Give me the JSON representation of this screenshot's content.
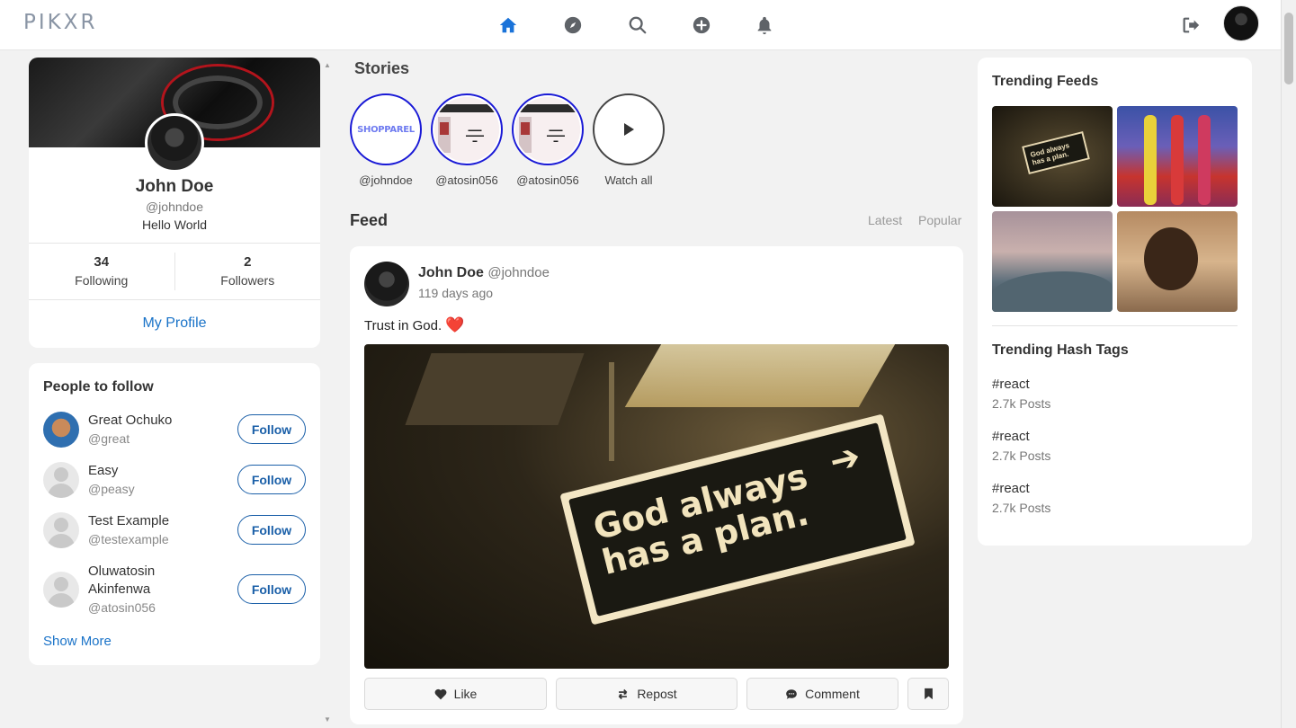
{
  "app": {
    "logo": "PIKXR"
  },
  "nav": {
    "icons": [
      "home-icon",
      "compass-icon",
      "search-icon",
      "plus-circle-icon",
      "bell-icon"
    ],
    "logout_icon": "logout-icon",
    "active_color": "#1a73d9"
  },
  "profile": {
    "name": "John Doe",
    "handle": "@johndoe",
    "bio": "Hello World",
    "following_count": "34",
    "following_label": "Following",
    "followers_count": "2",
    "followers_label": "Followers",
    "my_profile_label": "My Profile"
  },
  "people_to_follow": {
    "title": "People to follow",
    "users": [
      {
        "name": "Great Ochuko",
        "handle": "@great",
        "button": "Follow"
      },
      {
        "name": "Easy",
        "handle": "@peasy",
        "button": "Follow"
      },
      {
        "name": "Test Example",
        "handle": "@testexample",
        "button": "Follow"
      },
      {
        "name": "Oluwatosin Akinfenwa",
        "handle": "@atosin056",
        "button": "Follow"
      }
    ],
    "show_more": "Show More"
  },
  "stories": {
    "title": "Stories",
    "items": [
      {
        "label": "@johndoe",
        "thumb_text": "SHOPPAREL"
      },
      {
        "label": "@atosin056"
      },
      {
        "label": "@atosin056"
      },
      {
        "label": "Watch all"
      }
    ],
    "ring_color": "#1919d6"
  },
  "feed": {
    "title": "Feed",
    "tabs": [
      "Latest",
      "Popular"
    ]
  },
  "post": {
    "author": "John Doe",
    "handle": "@johndoe",
    "time": "119 days ago",
    "text": "Trust in God.",
    "emoji": "❤️",
    "image_text_line1": "God always",
    "image_text_line2": "has a plan.",
    "actions": {
      "like": "Like",
      "repost": "Repost",
      "comment": "Comment"
    }
  },
  "trending": {
    "feeds_title": "Trending Feeds",
    "mini_sign_line1": "God always",
    "mini_sign_line2": "has a plan.",
    "hashtags_title": "Trending Hash Tags",
    "hashtags": [
      {
        "tag": "#react",
        "count": "2.7k Posts"
      },
      {
        "tag": "#react",
        "count": "2.7k Posts"
      },
      {
        "tag": "#react",
        "count": "2.7k Posts"
      }
    ]
  }
}
